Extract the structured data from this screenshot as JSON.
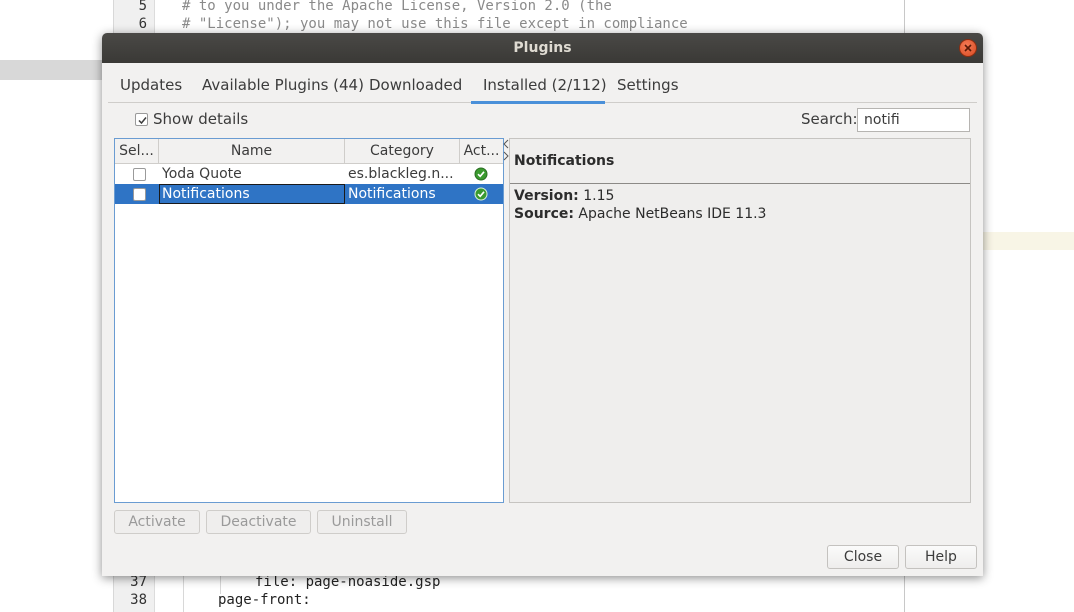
{
  "editor": {
    "top_lines": [
      {
        "num": "5",
        "text": "# to you under the Apache License, Version 2.0 (the"
      },
      {
        "num": "6",
        "text": "# \"License\"); you may not use this file except in compliance"
      }
    ],
    "bottom_lines": [
      {
        "num": "37",
        "text": "file: page-noaside.gsp"
      },
      {
        "num": "38",
        "text": "page-front:"
      }
    ]
  },
  "dialog": {
    "title": "Plugins",
    "tabs": [
      {
        "label": "Updates"
      },
      {
        "label": "Available Plugins (44)"
      },
      {
        "label": "Downloaded"
      },
      {
        "label": "Installed (2/112)"
      },
      {
        "label": "Settings"
      }
    ],
    "active_tab": "Installed (2/112)",
    "show_details_label": "Show details",
    "show_details_checked": true,
    "search_label": "Search:",
    "search_value": "notifi",
    "table": {
      "headers": [
        "Sel...",
        "Name",
        "Category",
        "Act..."
      ],
      "rows": [
        {
          "name": "Yoda Quote",
          "category": "es.blackleg.n...",
          "active": true,
          "selected": false
        },
        {
          "name": "Notifications",
          "category": "Notifications",
          "active": true,
          "selected": true
        }
      ]
    },
    "details": {
      "title": "Notifications",
      "version_label": "Version:",
      "version_value": "1.15",
      "source_label": "Source:",
      "source_value": "Apache NetBeans IDE 11.3"
    },
    "actions": {
      "activate": "Activate",
      "deactivate": "Deactivate",
      "uninstall": "Uninstall"
    },
    "close_label": "Close",
    "help_label": "Help"
  },
  "colors": {
    "titlebar": "#3a3936",
    "selection": "#2f74c5",
    "tab_underline": "#4a90d9",
    "close_button": "#e4572e",
    "active_check": "#3a9a2f"
  }
}
